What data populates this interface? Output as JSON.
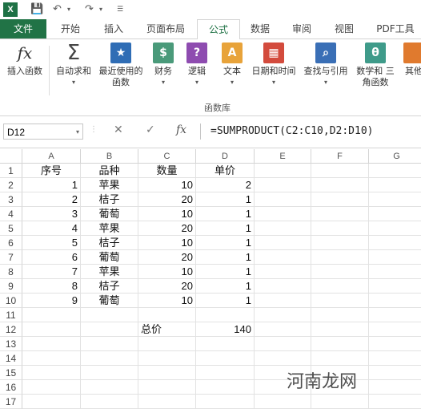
{
  "qat": {
    "app_icon": "X"
  },
  "tabs": [
    {
      "label": "文件",
      "file": true
    },
    {
      "label": "开始"
    },
    {
      "label": "插入"
    },
    {
      "label": "页面布局"
    },
    {
      "label": "公式",
      "active": true
    },
    {
      "label": "数据"
    },
    {
      "label": "审阅"
    },
    {
      "label": "视图"
    },
    {
      "label": "PDF工具"
    }
  ],
  "ribbon": {
    "buttons": [
      {
        "label": "插入函数",
        "icon": "fx-icon",
        "color": "#ffffff",
        "glyph": "fx"
      },
      {
        "label": "自动求和",
        "icon": "sigma-icon",
        "color": "#ffffff",
        "glyph": "Σ"
      },
      {
        "label": "最近使用的 函数",
        "icon": "star-icon",
        "color": "#2f6db5",
        "glyph": "★"
      },
      {
        "label": "财务",
        "icon": "money-icon",
        "color": "#4a9a7a",
        "glyph": "$"
      },
      {
        "label": "逻辑",
        "icon": "question-icon",
        "color": "#8e4cb0",
        "glyph": "?"
      },
      {
        "label": "文本",
        "icon": "text-icon",
        "color": "#e8a33a",
        "glyph": "A"
      },
      {
        "label": "日期和时间",
        "icon": "calendar-icon",
        "color": "#d34b3d",
        "glyph": "▦"
      },
      {
        "label": "查找与引用",
        "icon": "search-icon",
        "color": "#3a6fb6",
        "glyph": "⌕"
      },
      {
        "label": "数学和 三角函数",
        "icon": "theta-icon",
        "color": "#3f9b8a",
        "glyph": "θ"
      },
      {
        "label": "其他",
        "icon": "more-icon",
        "color": "#e07a2e",
        "glyph": ""
      }
    ],
    "group_label": "函数库"
  },
  "formula_bar": {
    "name_box": "D12",
    "cancel": "✕",
    "enter": "✓",
    "fx": "fx",
    "formula": "=SUMPRODUCT(C2:C10,D2:D10)"
  },
  "sheet": {
    "columns": [
      "A",
      "B",
      "C",
      "D",
      "E",
      "F",
      "G"
    ],
    "rows": [
      "1",
      "2",
      "3",
      "4",
      "5",
      "6",
      "7",
      "8",
      "9",
      "10",
      "11",
      "12",
      "13",
      "14",
      "15",
      "16",
      "17"
    ],
    "cells": [
      [
        "序号",
        "品种",
        "数量",
        "单价",
        "",
        "",
        ""
      ],
      [
        "1",
        "苹果",
        "10",
        "2",
        "",
        "",
        ""
      ],
      [
        "2",
        "桔子",
        "20",
        "1",
        "",
        "",
        ""
      ],
      [
        "3",
        "葡萄",
        "10",
        "1",
        "",
        "",
        ""
      ],
      [
        "4",
        "苹果",
        "20",
        "1",
        "",
        "",
        ""
      ],
      [
        "5",
        "桔子",
        "10",
        "1",
        "",
        "",
        ""
      ],
      [
        "6",
        "葡萄",
        "20",
        "1",
        "",
        "",
        ""
      ],
      [
        "7",
        "苹果",
        "10",
        "1",
        "",
        "",
        ""
      ],
      [
        "8",
        "桔子",
        "20",
        "1",
        "",
        "",
        ""
      ],
      [
        "9",
        "葡萄",
        "10",
        "1",
        "",
        "",
        ""
      ],
      [
        "",
        "",
        "",
        "",
        "",
        "",
        ""
      ],
      [
        "",
        "",
        "总价",
        "140",
        "",
        "",
        ""
      ],
      [
        "",
        "",
        "",
        "",
        "",
        "",
        ""
      ],
      [
        "",
        "",
        "",
        "",
        "",
        "",
        ""
      ],
      [
        "",
        "",
        "",
        "",
        "",
        "",
        ""
      ],
      [
        "",
        "",
        "",
        "",
        "",
        "",
        ""
      ],
      [
        "",
        "",
        "",
        "",
        "",
        "",
        ""
      ]
    ]
  },
  "watermark": "河南龙网"
}
